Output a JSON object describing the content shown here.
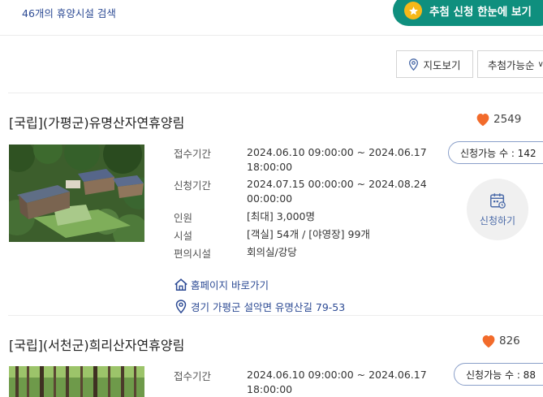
{
  "header": {
    "result_count": "46개의 휴양시설 검색",
    "lottery_button": "추첨 신청 한눈에 보기",
    "map_button": "지도보기",
    "sort_label": "추첨가능순"
  },
  "labels": {
    "reception_period": "접수기간",
    "application_period": "신청기간",
    "capacity": "인원",
    "facilities": "시설",
    "amenities": "편의시설",
    "homepage_link": "홈페이지 바로가기",
    "apply_button": "신청하기"
  },
  "colors": {
    "brand": "#0f8f7e",
    "link": "#2c4a94",
    "heart": "#f26b2b",
    "star": "#f6b819"
  },
  "facilities": [
    {
      "name": "[국립](가평군)유명산자연휴양림",
      "likes": "2549",
      "available": "신청가능 수 : 142",
      "reception_line1": "2024.06.10 09:00:00 ~ 2024.06.17",
      "reception_line2": "18:00:00",
      "application_line1": "2024.07.15 00:00:00 ~ 2024.08.24",
      "application_line2": "00:00:00",
      "capacity": "[최대] 3,000명",
      "rooms": "[객실] 54개 / [야영장] 99개",
      "amenities": "회의실/강당",
      "address": "경기 가평군 설악면 유명산길 79-53"
    },
    {
      "name": "[국립](서천군)희리산자연휴양림",
      "likes": "826",
      "available": "신청가능 수 : 88",
      "reception_line1": "2024.06.10 09:00:00 ~ 2024.06.17",
      "reception_line2": "18:00:00"
    }
  ]
}
